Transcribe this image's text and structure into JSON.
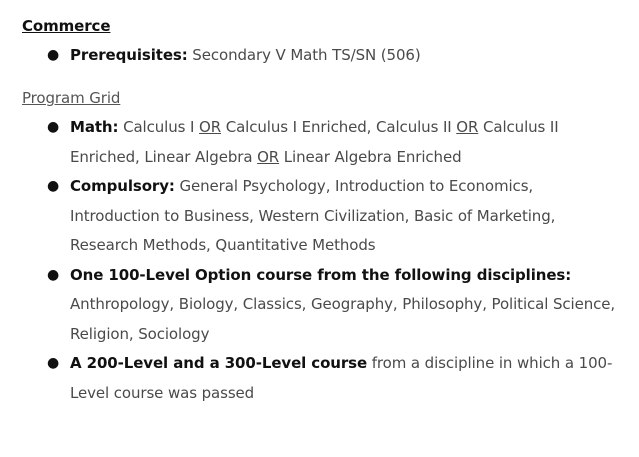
{
  "commerce": {
    "heading": "Commerce",
    "items": [
      {
        "bullet": "●",
        "label": "Prerequisites:",
        "text": " Secondary V Math TS/SN (506)"
      }
    ]
  },
  "program_grid": {
    "heading": "Program Grid",
    "math": {
      "bullet": "●",
      "label": "Math:",
      "t1": " Calculus I ",
      "or1": "OR",
      "t2": " Calculus I Enriched, Calculus II ",
      "or2": "OR",
      "t3": " Calculus II Enriched, Linear Algebra ",
      "or3": "OR",
      "t4": " Linear Algebra Enriched"
    },
    "compulsory": {
      "bullet": "●",
      "label": "Compulsory:",
      "text": " General Psychology, Introduction to Economics, Introduction to Business, Western Civilization, Basic of Marketing, Research Methods, Quantitative Methods"
    },
    "option": {
      "bullet": "●",
      "label": "One 100-Level Option course from the following disciplines:",
      "text": " Anthropology, Biology, Classics, Geography, Philosophy, Political Science, Religion, Sociology"
    },
    "level": {
      "bullet": "●",
      "label": "A 200-Level and a 300-Level course",
      "text": " from a discipline in which a 100-Level course was passed"
    }
  }
}
